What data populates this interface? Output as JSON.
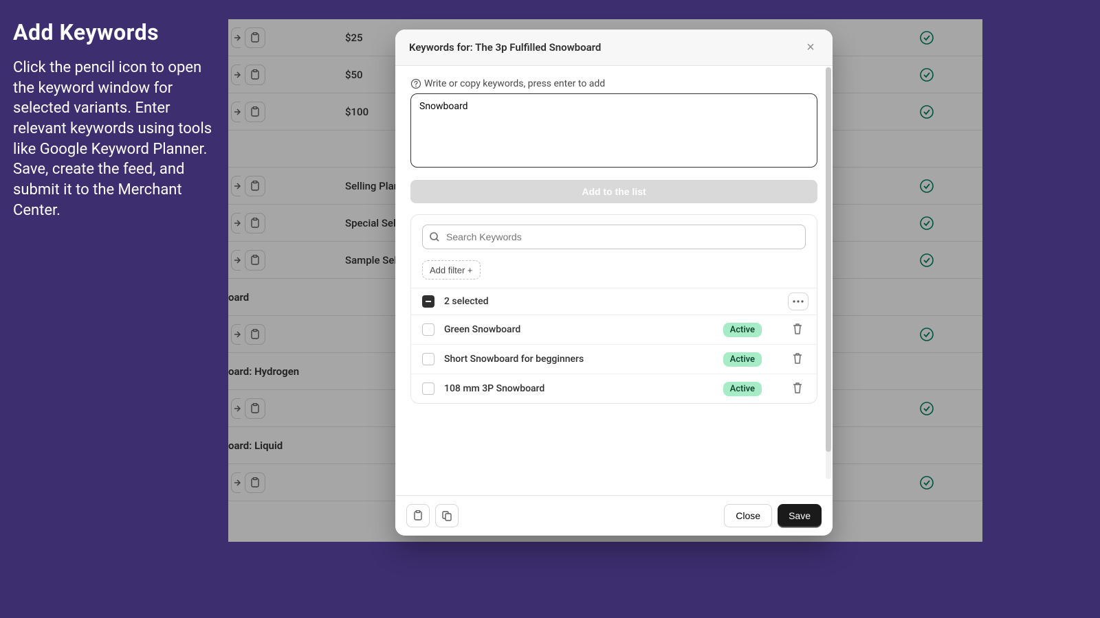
{
  "sidebar": {
    "title": "Add Keywords",
    "description": "Click the pencil icon to open the keyword window for selected variants. Enter relevant keywords using tools like Google Keyword Planner. Save, create the feed, and submit it to the Merchant Center."
  },
  "table": {
    "rows": [
      {
        "label": "$25"
      },
      {
        "label": "$50"
      },
      {
        "label": "$100"
      }
    ],
    "rows2": [
      {
        "label": "Selling Plans S"
      },
      {
        "label": "Special Selling"
      },
      {
        "label": "Sample Selling"
      }
    ],
    "group1": "oard",
    "group2": "oard: Hydrogen",
    "group3": "oard: Liquid"
  },
  "modal": {
    "title": "Keywords for: The 3p Fulfilled Snowboard",
    "input_label": "Write or copy keywords, press enter to add",
    "textarea_value": "Snowboard",
    "add_button": "Add to the list",
    "search_placeholder": "Search Keywords",
    "filter_label": "Add filter +",
    "selected_text": "2 selected",
    "keywords": [
      {
        "name": "Green Snowboard",
        "status": "Active"
      },
      {
        "name": "Short Snowboard for begginners",
        "status": "Active"
      },
      {
        "name": "108 mm 3P Snowboard",
        "status": "Active"
      }
    ],
    "close_label": "Close",
    "save_label": "Save"
  }
}
